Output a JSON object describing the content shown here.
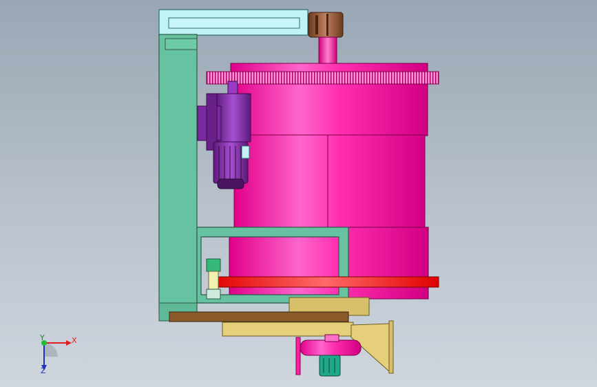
{
  "triad": {
    "x_label": "X",
    "y_label": "Y",
    "z_label": "Z"
  },
  "colors": {
    "background_top": "#9aa6b4",
    "frame": "#66c2a0",
    "frame_edge": "#2d5a48",
    "drum": "#ff1fa5",
    "drum_edge": "#7a0047",
    "motor": "#8a2bb0",
    "motor_edge": "#3a0d4d",
    "red_band": "#ff1a1a",
    "base_plate": "#e6cf7a",
    "brown_bar": "#8b5a2b",
    "cyan_panel": "#bff3f5",
    "teal_motor": "#1fa88a"
  }
}
